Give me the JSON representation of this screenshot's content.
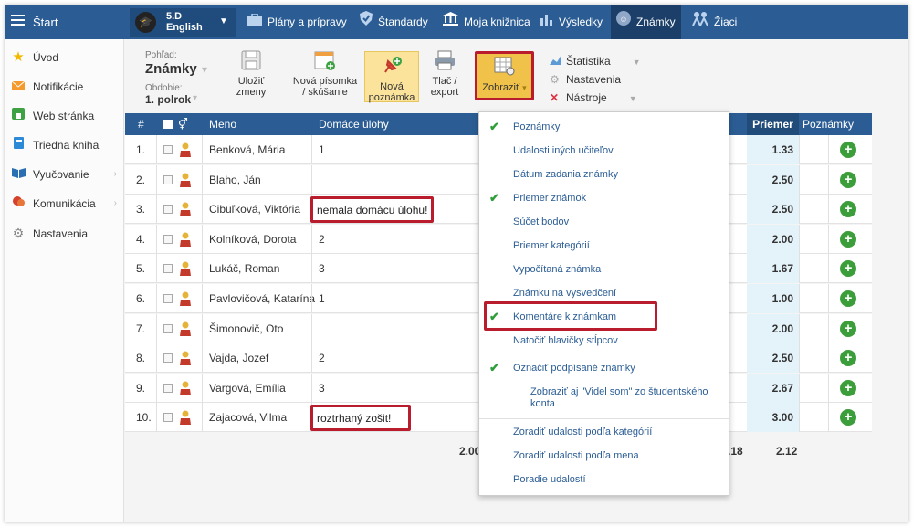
{
  "topbar": {
    "start_label": "Štart",
    "class_line1": "5.D",
    "class_line2": "English",
    "items": [
      {
        "label": "Plány a prípravy"
      },
      {
        "label": "Štandardy"
      },
      {
        "label": "Moja knižnica"
      },
      {
        "label": "Výsledky"
      },
      {
        "label": "Známky"
      },
      {
        "label": "Žiaci"
      }
    ]
  },
  "sidebar": {
    "items": [
      {
        "label": "Úvod"
      },
      {
        "label": "Notifikácie"
      },
      {
        "label": "Web stránka"
      },
      {
        "label": "Triedna kniha"
      },
      {
        "label": "Vyučovanie"
      },
      {
        "label": "Komunikácia"
      },
      {
        "label": "Nastavenia"
      }
    ]
  },
  "toolbar": {
    "view_label": "Pohľad:",
    "view_value": "Známky",
    "period_label": "Obdobie:",
    "period_value": "1. polrok",
    "save_line1": "Uložiť",
    "save_line2": "zmeny",
    "test_line1": "Nová písomka",
    "test_line2": "/ skúšanie",
    "note_line1": "Nová",
    "note_line2": "poznámka",
    "print_line1": "Tlač /",
    "print_line2": "export",
    "show_label": "Zobraziť",
    "stats_label": "Štatistika",
    "settings_label": "Nastavenia",
    "tools_label": "Nástroje"
  },
  "table": {
    "headers": {
      "num": "#",
      "name": "Meno",
      "homework": "Domáce úlohy",
      "avg": "Priemer",
      "notes": "Poznámky"
    },
    "rows": [
      {
        "num": "1.",
        "name": "Benková, Mária",
        "homework": "1",
        "avg": "1.33"
      },
      {
        "num": "2.",
        "name": "Blaho, Ján",
        "homework": "",
        "avg": "2.50"
      },
      {
        "num": "3.",
        "name": "Cibuľková, Viktória",
        "homework": "nemala domácu úlohu!",
        "avg": "2.50"
      },
      {
        "num": "4.",
        "name": "Kolníková, Dorota",
        "homework": "2",
        "avg": "2.00"
      },
      {
        "num": "5.",
        "name": "Lukáč, Roman",
        "homework": "3",
        "avg": "1.67"
      },
      {
        "num": "6.",
        "name": "Pavlovičová, Katarína",
        "homework": "1",
        "avg": "1.00"
      },
      {
        "num": "7.",
        "name": "Šimonovič, Oto",
        "homework": "",
        "avg": "2.00"
      },
      {
        "num": "8.",
        "name": "Vajda, Jozef",
        "homework": "2",
        "avg": "2.50"
      },
      {
        "num": "9.",
        "name": "Vargová, Emília",
        "homework": "3",
        "avg": "2.67"
      },
      {
        "num": "10.",
        "name": "Zajacová, Vilma",
        "homework": "roztrhaný zošit!",
        "avg": "3.00"
      }
    ],
    "footer": {
      "homework_avg": "2.00",
      "partial": ".18",
      "avg": "2.12"
    }
  },
  "dropdown": {
    "items": [
      {
        "label": "Poznámky",
        "checked": true
      },
      {
        "label": "Udalosti iných učiteľov",
        "checked": false
      },
      {
        "label": "Dátum zadania známky",
        "checked": false
      },
      {
        "label": "Priemer známok",
        "checked": true
      },
      {
        "label": "Súčet bodov",
        "checked": false
      },
      {
        "label": "Priemer kategórií",
        "checked": false
      },
      {
        "label": "Vypočítaná známka",
        "checked": false
      },
      {
        "label": "Známku na vysvedčení",
        "checked": false
      },
      {
        "label": "Komentáre k známkam",
        "checked": true
      },
      {
        "label": "Natočiť hlavičky stĺpcov",
        "checked": false
      }
    ],
    "signed_label": "Označiť podpísané známky",
    "signed_sub": "Zobraziť aj \"Videl som\" zo študentského konta",
    "sort_items": [
      {
        "label": "Zoradiť udalosti podľa kategórií"
      },
      {
        "label": "Zoradiť udalosti podľa mena"
      },
      {
        "label": "Poradie udalostí"
      }
    ]
  },
  "colors": {
    "brand": "#2b5d94",
    "highlight": "#b91c2c",
    "accent": "#f1c24a",
    "add": "#3c9e3a"
  }
}
